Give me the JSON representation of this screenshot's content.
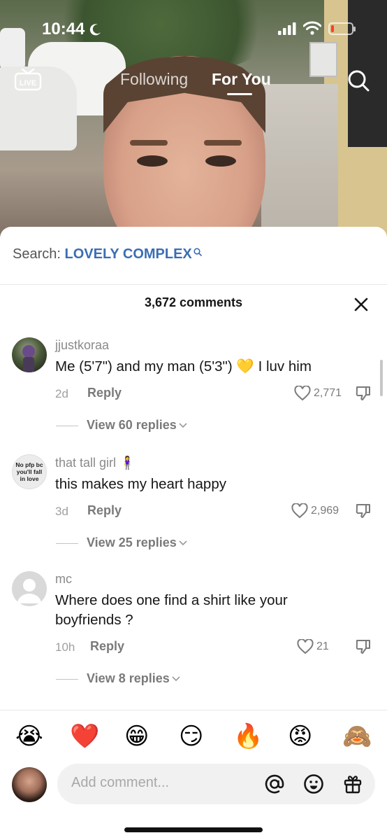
{
  "status_bar": {
    "time": "10:44"
  },
  "top_nav": {
    "live_label": "LIVE",
    "tabs": [
      {
        "label": "Following",
        "active": false
      },
      {
        "label": "For You",
        "active": true
      }
    ]
  },
  "search": {
    "prefix": "Search:",
    "term": "LOVELY COMPLEX"
  },
  "comments_header": {
    "count_text": "3,672 comments"
  },
  "comments": [
    {
      "username": "jjustkoraa",
      "text": "Me (5'7\") and my man (5'3\") 💛 I luv him",
      "time": "2d",
      "reply_label": "Reply",
      "likes": "2,771",
      "view_replies": "View 60 replies"
    },
    {
      "username": "that tall girl 🧍‍♀️",
      "avatar_text": "No pfp bc you'll fall in love",
      "text": "this makes my heart happy",
      "time": "3d",
      "reply_label": "Reply",
      "likes": "2,969",
      "view_replies": "View 25 replies"
    },
    {
      "username": "mc",
      "text": "Where does one find a shirt like your boyfriends ?",
      "time": "10h",
      "reply_label": "Reply",
      "likes": "21",
      "view_replies": "View 8 replies"
    }
  ],
  "emoji_bar": [
    "😭",
    "❤️",
    "😁",
    "😏",
    "🔥",
    "😡",
    "🙈"
  ],
  "composer": {
    "placeholder": "Add comment..."
  },
  "colors": {
    "accent_link": "#3b6db3",
    "text_primary": "#161616",
    "text_secondary": "#8a8a8a"
  }
}
